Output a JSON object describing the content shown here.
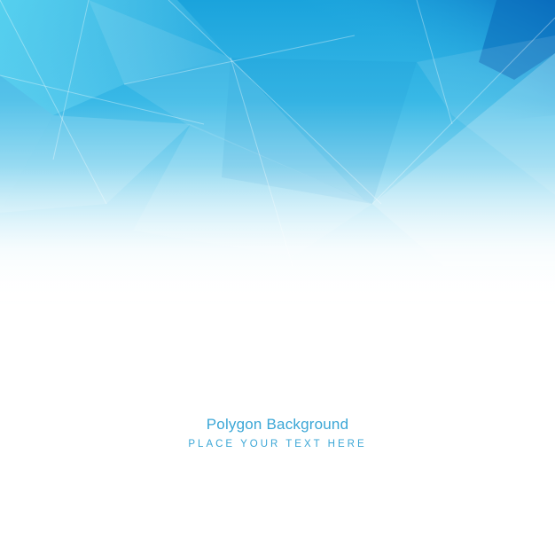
{
  "artwork": {
    "title": "Polygon Background",
    "subtitle": "PLACE YOUR TEXT HERE"
  },
  "colors": {
    "deep_blue": "#0a72c4",
    "mid_blue": "#23a9dc",
    "light_cyan": "#5fd6f0",
    "text_blue": "#3aa6d6",
    "background": "#ffffff"
  }
}
